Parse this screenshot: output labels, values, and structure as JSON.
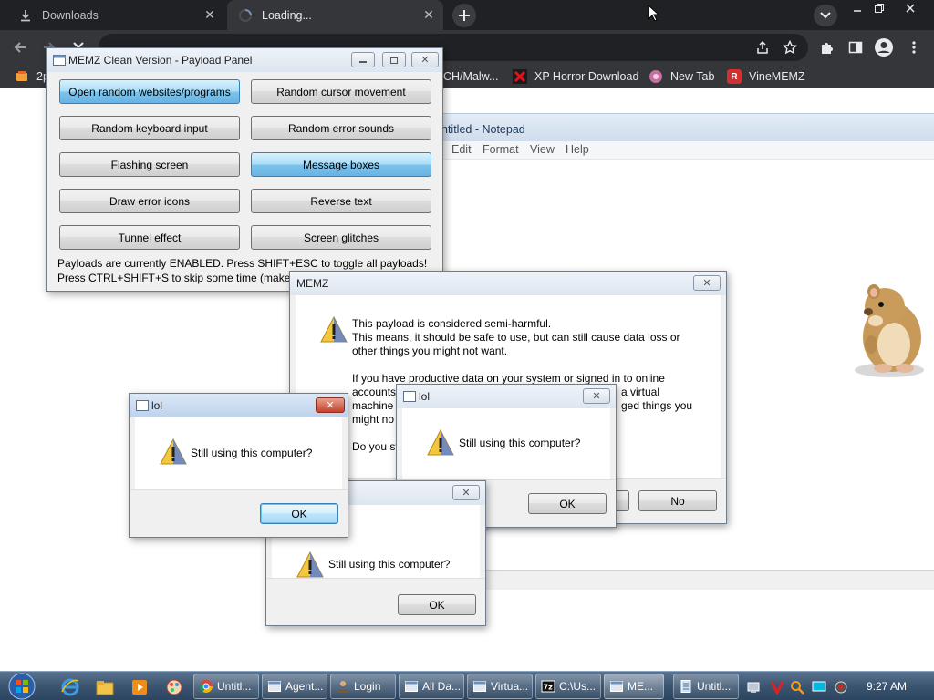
{
  "browser": {
    "tabs": [
      {
        "label": "Downloads",
        "icon": "download-icon"
      },
      {
        "label": "Loading...",
        "icon": "loading-spinner-icon"
      }
    ],
    "bookmarks": [
      {
        "label": "2p",
        "icon": "bookmark-icon"
      },
      {
        "label": "CH/Malw...",
        "icon": "bookmark-icon"
      },
      {
        "label": "XP Horror Download",
        "icon": "x-logo-icon",
        "color": "#e8111a"
      },
      {
        "label": "New Tab",
        "icon": "globe-icon"
      },
      {
        "label": "VineMEMZ",
        "icon": "r-logo-icon",
        "color": "#d32f2f"
      }
    ]
  },
  "notepad": {
    "title": "ntitled - Notepad",
    "menus": [
      "Edit",
      "Format",
      "View",
      "Help"
    ]
  },
  "memz_panel": {
    "title": "MEMZ Clean Version - Payload Panel",
    "payloads": [
      {
        "label": "Open random websites/programs",
        "active": true
      },
      {
        "label": "Random cursor movement",
        "active": false
      },
      {
        "label": "Random keyboard input",
        "active": false
      },
      {
        "label": "Random error sounds",
        "active": false
      },
      {
        "label": "Flashing screen",
        "active": false
      },
      {
        "label": "Message boxes",
        "active": true
      },
      {
        "label": "Draw error icons",
        "active": false
      },
      {
        "label": "Reverse text",
        "active": false
      },
      {
        "label": "Tunnel effect",
        "active": false
      },
      {
        "label": "Screen glitches",
        "active": false
      }
    ],
    "status1": "Payloads are currently ENABLED. Press SHIFT+ESC to toggle all payloads!",
    "status2": "Press CTRL+SHIFT+S to skip some time (makes some"
  },
  "memz_dialog": {
    "title": "MEMZ",
    "lines": [
      "This payload is considered semi-harmful.",
      "This means, it should be safe to use, but can still cause data loss or",
      "other things you might not want.",
      "",
      "If you have productive data on your system or signed in to online",
      "accounts,",
      "machine",
      "might no",
      "",
      "Do you st"
    ],
    "frag_virtual": "a virtual",
    "frag_things": "ged things you",
    "no_label": "No"
  },
  "lol_dialog_1": {
    "title": "lol",
    "message": "Still using this computer?",
    "ok_label": "OK"
  },
  "lol_dialog_2": {
    "title": "lol",
    "message": "Still using this computer?",
    "ok_label": "OK"
  },
  "lol_dialog_3": {
    "message": "Still using this computer?",
    "ok_label": "OK"
  },
  "taskbar": {
    "buttons": [
      {
        "label": "Untitl...",
        "icon": "chrome-icon"
      },
      {
        "label": "Agent...",
        "icon": "window-icon"
      },
      {
        "label": "Login",
        "icon": "user-icon"
      },
      {
        "label": "All Da...",
        "icon": "window-icon"
      },
      {
        "label": "Virtua...",
        "icon": "window-icon"
      },
      {
        "label": "C:\\Us...",
        "icon": "7zip-icon"
      },
      {
        "label": "ME...",
        "icon": "window-icon"
      },
      {
        "label": "Untitl...",
        "icon": "notepad-icon"
      }
    ],
    "clock": "9:27 AM"
  }
}
